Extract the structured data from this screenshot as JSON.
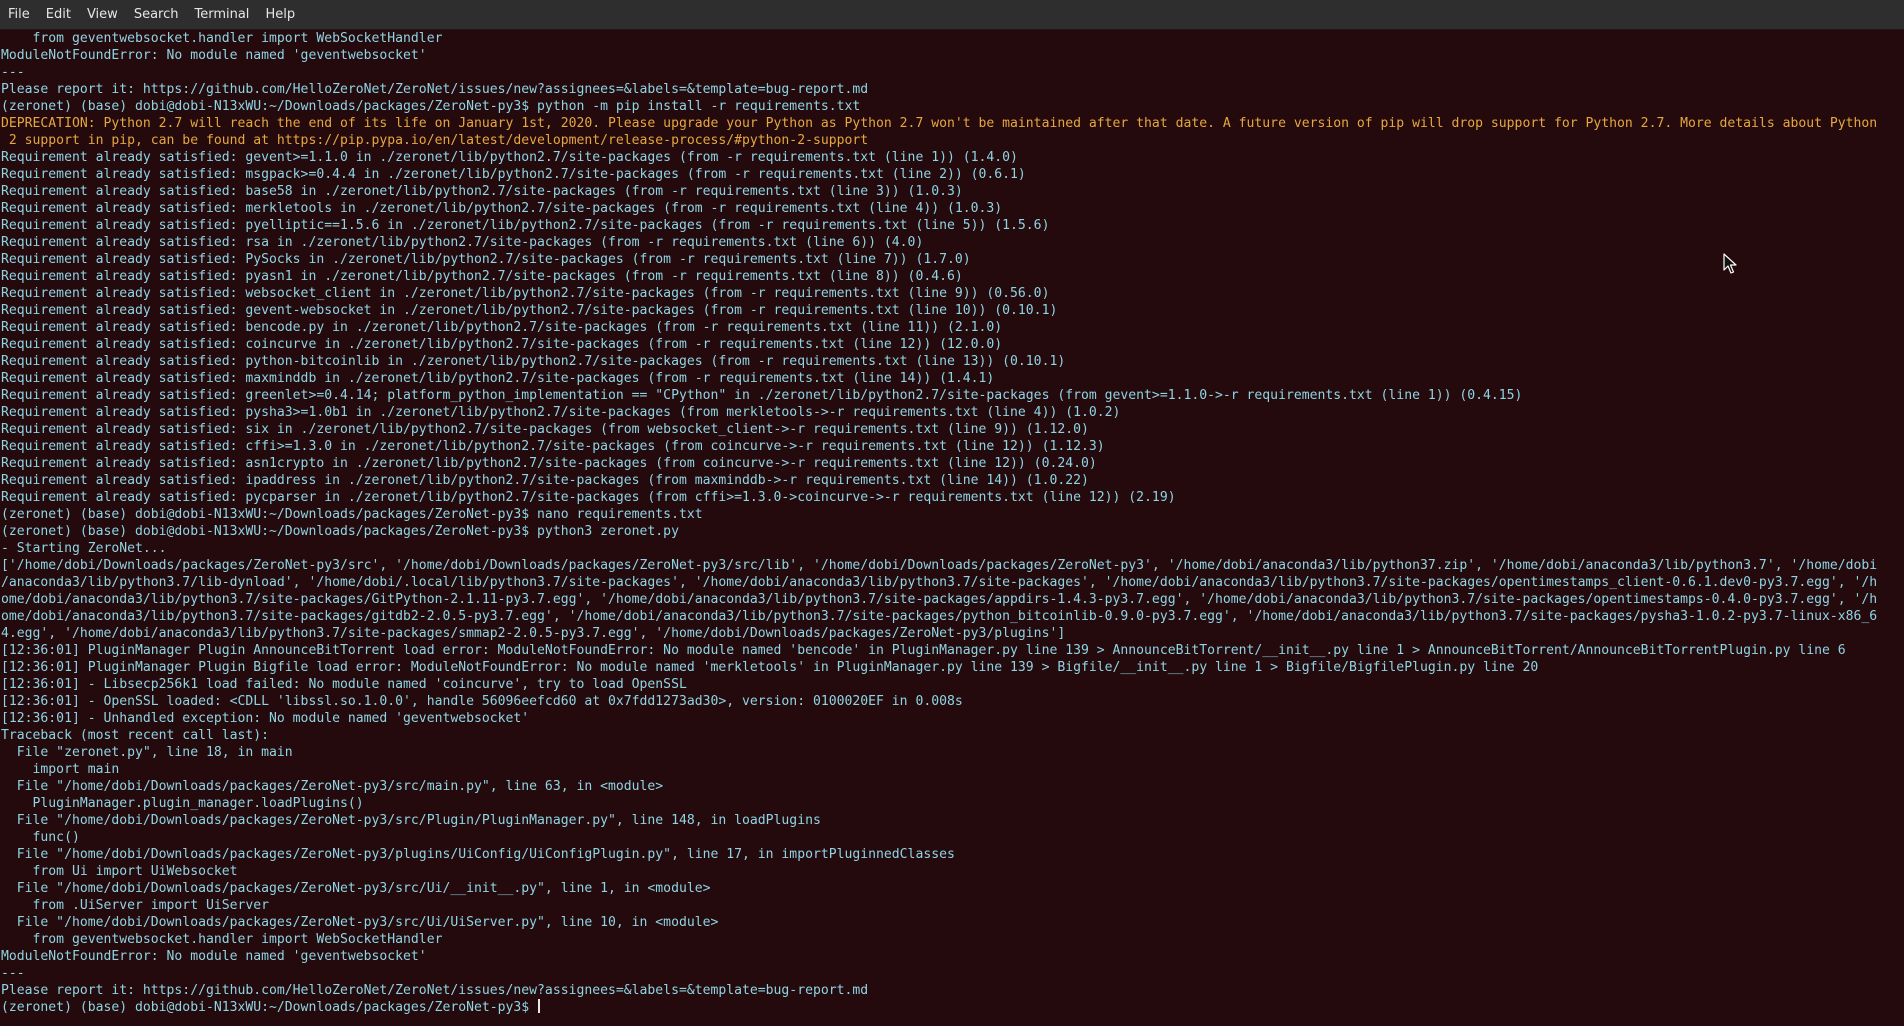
{
  "menubar": {
    "items": [
      "File",
      "Edit",
      "View",
      "Search",
      "Terminal",
      "Help"
    ]
  },
  "colors": {
    "background": "#240a0d",
    "text": "#8fd4e3",
    "warning": "#e6a73f",
    "menubar": "#2e2e2e"
  },
  "terminal": {
    "lines": [
      {
        "t": "    from geventwebsocket.handler import WebSocketHandler"
      },
      {
        "t": "ModuleNotFoundError: No module named 'geventwebsocket'"
      },
      {
        "t": "---"
      },
      {
        "t": "Please report it: https://github.com/HelloZeroNet/ZeroNet/issues/new?assignees=&labels=&template=bug-report.md"
      },
      {
        "t": "(zeronet) (base) dobi@dobi-N13xWU:~/Downloads/packages/ZeroNet-py3$ python -m pip install -r requirements.txt"
      },
      {
        "t": "DEPRECATION: Python 2.7 will reach the end of its life on January 1st, 2020. Please upgrade your Python as Python 2.7 won't be maintained after that date. A future version of pip will drop support for Python 2.7. More details about Python",
        "k": "warn"
      },
      {
        "t": " 2 support in pip, can be found at https://pip.pypa.io/en/latest/development/release-process/#python-2-support",
        "k": "warn"
      },
      {
        "t": "Requirement already satisfied: gevent>=1.1.0 in ./zeronet/lib/python2.7/site-packages (from -r requirements.txt (line 1)) (1.4.0)"
      },
      {
        "t": "Requirement already satisfied: msgpack>=0.4.4 in ./zeronet/lib/python2.7/site-packages (from -r requirements.txt (line 2)) (0.6.1)"
      },
      {
        "t": "Requirement already satisfied: base58 in ./zeronet/lib/python2.7/site-packages (from -r requirements.txt (line 3)) (1.0.3)"
      },
      {
        "t": "Requirement already satisfied: merkletools in ./zeronet/lib/python2.7/site-packages (from -r requirements.txt (line 4)) (1.0.3)"
      },
      {
        "t": "Requirement already satisfied: pyelliptic==1.5.6 in ./zeronet/lib/python2.7/site-packages (from -r requirements.txt (line 5)) (1.5.6)"
      },
      {
        "t": "Requirement already satisfied: rsa in ./zeronet/lib/python2.7/site-packages (from -r requirements.txt (line 6)) (4.0)"
      },
      {
        "t": "Requirement already satisfied: PySocks in ./zeronet/lib/python2.7/site-packages (from -r requirements.txt (line 7)) (1.7.0)"
      },
      {
        "t": "Requirement already satisfied: pyasn1 in ./zeronet/lib/python2.7/site-packages (from -r requirements.txt (line 8)) (0.4.6)"
      },
      {
        "t": "Requirement already satisfied: websocket_client in ./zeronet/lib/python2.7/site-packages (from -r requirements.txt (line 9)) (0.56.0)"
      },
      {
        "t": "Requirement already satisfied: gevent-websocket in ./zeronet/lib/python2.7/site-packages (from -r requirements.txt (line 10)) (0.10.1)"
      },
      {
        "t": "Requirement already satisfied: bencode.py in ./zeronet/lib/python2.7/site-packages (from -r requirements.txt (line 11)) (2.1.0)"
      },
      {
        "t": "Requirement already satisfied: coincurve in ./zeronet/lib/python2.7/site-packages (from -r requirements.txt (line 12)) (12.0.0)"
      },
      {
        "t": "Requirement already satisfied: python-bitcoinlib in ./zeronet/lib/python2.7/site-packages (from -r requirements.txt (line 13)) (0.10.1)"
      },
      {
        "t": "Requirement already satisfied: maxminddb in ./zeronet/lib/python2.7/site-packages (from -r requirements.txt (line 14)) (1.4.1)"
      },
      {
        "t": "Requirement already satisfied: greenlet>=0.4.14; platform_python_implementation == \"CPython\" in ./zeronet/lib/python2.7/site-packages (from gevent>=1.1.0->-r requirements.txt (line 1)) (0.4.15)"
      },
      {
        "t": "Requirement already satisfied: pysha3>=1.0b1 in ./zeronet/lib/python2.7/site-packages (from merkletools->-r requirements.txt (line 4)) (1.0.2)"
      },
      {
        "t": "Requirement already satisfied: six in ./zeronet/lib/python2.7/site-packages (from websocket_client->-r requirements.txt (line 9)) (1.12.0)"
      },
      {
        "t": "Requirement already satisfied: cffi>=1.3.0 in ./zeronet/lib/python2.7/site-packages (from coincurve->-r requirements.txt (line 12)) (1.12.3)"
      },
      {
        "t": "Requirement already satisfied: asn1crypto in ./zeronet/lib/python2.7/site-packages (from coincurve->-r requirements.txt (line 12)) (0.24.0)"
      },
      {
        "t": "Requirement already satisfied: ipaddress in ./zeronet/lib/python2.7/site-packages (from maxminddb->-r requirements.txt (line 14)) (1.0.22)"
      },
      {
        "t": "Requirement already satisfied: pycparser in ./zeronet/lib/python2.7/site-packages (from cffi>=1.3.0->coincurve->-r requirements.txt (line 12)) (2.19)"
      },
      {
        "t": "(zeronet) (base) dobi@dobi-N13xWU:~/Downloads/packages/ZeroNet-py3$ nano requirements.txt"
      },
      {
        "t": "(zeronet) (base) dobi@dobi-N13xWU:~/Downloads/packages/ZeroNet-py3$ python3 zeronet.py"
      },
      {
        "t": "- Starting ZeroNet..."
      },
      {
        "t": "['/home/dobi/Downloads/packages/ZeroNet-py3/src', '/home/dobi/Downloads/packages/ZeroNet-py3/src/lib', '/home/dobi/Downloads/packages/ZeroNet-py3', '/home/dobi/anaconda3/lib/python37.zip', '/home/dobi/anaconda3/lib/python3.7', '/home/dobi"
      },
      {
        "t": "/anaconda3/lib/python3.7/lib-dynload', '/home/dobi/.local/lib/python3.7/site-packages', '/home/dobi/anaconda3/lib/python3.7/site-packages', '/home/dobi/anaconda3/lib/python3.7/site-packages/opentimestamps_client-0.6.1.dev0-py3.7.egg', '/h"
      },
      {
        "t": "ome/dobi/anaconda3/lib/python3.7/site-packages/GitPython-2.1.11-py3.7.egg', '/home/dobi/anaconda3/lib/python3.7/site-packages/appdirs-1.4.3-py3.7.egg', '/home/dobi/anaconda3/lib/python3.7/site-packages/opentimestamps-0.4.0-py3.7.egg', '/h"
      },
      {
        "t": "ome/dobi/anaconda3/lib/python3.7/site-packages/gitdb2-2.0.5-py3.7.egg', '/home/dobi/anaconda3/lib/python3.7/site-packages/python_bitcoinlib-0.9.0-py3.7.egg', '/home/dobi/anaconda3/lib/python3.7/site-packages/pysha3-1.0.2-py3.7-linux-x86_6"
      },
      {
        "t": "4.egg', '/home/dobi/anaconda3/lib/python3.7/site-packages/smmap2-2.0.5-py3.7.egg', '/home/dobi/Downloads/packages/ZeroNet-py3/plugins']"
      },
      {
        "t": "[12:36:01] PluginManager Plugin AnnounceBitTorrent load error: ModuleNotFoundError: No module named 'bencode' in PluginManager.py line 139 > AnnounceBitTorrent/__init__.py line 1 > AnnounceBitTorrent/AnnounceBitTorrentPlugin.py line 6"
      },
      {
        "t": "[12:36:01] PluginManager Plugin Bigfile load error: ModuleNotFoundError: No module named 'merkletools' in PluginManager.py line 139 > Bigfile/__init__.py line 1 > Bigfile/BigfilePlugin.py line 20"
      },
      {
        "t": "[12:36:01] - Libsecp256k1 load failed: No module named 'coincurve', try to load OpenSSL"
      },
      {
        "t": "[12:36:01] - OpenSSL loaded: <CDLL 'libssl.so.1.0.0', handle 56096eefcd60 at 0x7fdd1273ad30>, version: 0100020EF in 0.008s"
      },
      {
        "t": "[12:36:01] - Unhandled exception: No module named 'geventwebsocket'"
      },
      {
        "t": "Traceback (most recent call last):"
      },
      {
        "t": "  File \"zeronet.py\", line 18, in main"
      },
      {
        "t": "    import main"
      },
      {
        "t": "  File \"/home/dobi/Downloads/packages/ZeroNet-py3/src/main.py\", line 63, in <module>"
      },
      {
        "t": "    PluginManager.plugin_manager.loadPlugins()"
      },
      {
        "t": "  File \"/home/dobi/Downloads/packages/ZeroNet-py3/src/Plugin/PluginManager.py\", line 148, in loadPlugins"
      },
      {
        "t": "    func()"
      },
      {
        "t": "  File \"/home/dobi/Downloads/packages/ZeroNet-py3/plugins/UiConfig/UiConfigPlugin.py\", line 17, in importPluginnedClasses"
      },
      {
        "t": "    from Ui import UiWebsocket"
      },
      {
        "t": "  File \"/home/dobi/Downloads/packages/ZeroNet-py3/src/Ui/__init__.py\", line 1, in <module>"
      },
      {
        "t": "    from .UiServer import UiServer"
      },
      {
        "t": "  File \"/home/dobi/Downloads/packages/ZeroNet-py3/src/Ui/UiServer.py\", line 10, in <module>"
      },
      {
        "t": "    from geventwebsocket.handler import WebSocketHandler"
      },
      {
        "t": "ModuleNotFoundError: No module named 'geventwebsocket'"
      },
      {
        "t": "---"
      },
      {
        "t": "Please report it: https://github.com/HelloZeroNet/ZeroNet/issues/new?assignees=&labels=&template=bug-report.md"
      },
      {
        "t": "(zeronet) (base) dobi@dobi-N13xWU:~/Downloads/packages/ZeroNet-py3$ ",
        "cursor": true
      }
    ]
  }
}
